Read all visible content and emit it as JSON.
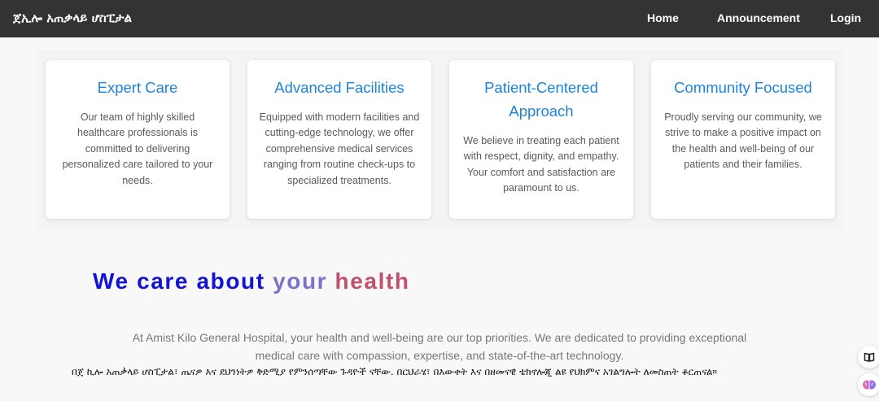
{
  "nav": {
    "brand": "ጀኢሎ አጠቃላይ ሆስፒታል",
    "links": [
      "Home",
      "Announcement",
      "Login"
    ]
  },
  "features": [
    {
      "title": "Expert Care",
      "text": "Our team of highly skilled healthcare professionals is committed to delivering personalized care tailored to your needs."
    },
    {
      "title": "Advanced Facilities",
      "text": "Equipped with modern facilities and cutting-edge technology, we offer comprehensive medical services ranging from routine check-ups to specialized treatments."
    },
    {
      "title": "Patient-Centered Approach",
      "text": "We believe in treating each patient with respect, dignity, and empathy. Your comfort and satisfaction are paramount to us."
    },
    {
      "title": "Community Focused",
      "text": "Proudly serving our community, we strive to make a positive impact on the health and well-being of our patients and their families."
    }
  ],
  "hero": {
    "part1": "We care about ",
    "part2": "your ",
    "part3": "health"
  },
  "description": "At Amist Kilo General Hospital, your health and well-being are our top priorities. We are dedicated to providing exceptional medical care with compassion, expertise, and state-of-the-art technology.",
  "description_amharic": "በጀ ኪሎ አጠቃላይ ሆስፒታል፣ ጤናዎ እና ደህንነትዎ ቅድሚያ የምንሰጣቸው ጉዳዮች ናቸው. በርህራሄ፣ በእውቀት እና በዘመናዊ ቴክኖሎጂ ልዩ የህክምና አገልግሎት ለመስጠት ቆርጠናል።",
  "colors": {
    "navbar": "#333333",
    "card_title": "#1d84d8",
    "hero_1": "#1313d8",
    "hero_2": "#7a72c8",
    "hero_3": "#c0506e"
  },
  "side_icons": [
    "book-icon",
    "brain-icon"
  ]
}
